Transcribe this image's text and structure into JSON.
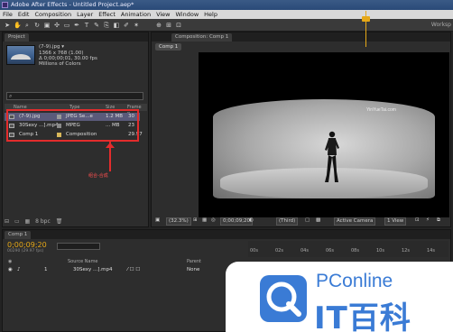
{
  "window": {
    "title": "Adobe After Effects - Untitled Project.aep*"
  },
  "menu": [
    "File",
    "Edit",
    "Composition",
    "Layer",
    "Effect",
    "Animation",
    "View",
    "Window",
    "Help"
  ],
  "toolbar": {
    "workspace": "Worksp"
  },
  "project": {
    "tab": "Project",
    "selected_item": {
      "name": "(7-9).jpg ▾",
      "dims": "1366 x 768 (1.00)",
      "duration": "Δ 0;00;00;01, 30.00 fps",
      "colors": "Millions of Colors"
    },
    "columns": [
      "Name",
      "Type",
      "Size",
      "Frame R..."
    ],
    "items": [
      {
        "name": "(7-9).jpg",
        "type": "JPEG Se...e",
        "size": "1.2 MB",
        "frame": "30",
        "swatch": "#9a9a9a"
      },
      {
        "name": "30Sexy ...].mp4",
        "type": "MPEG",
        "size": "... MB",
        "frame": "23",
        "swatch": "#8a8a8a"
      },
      {
        "name": "Comp 1",
        "type": "Composition",
        "size": "",
        "frame": "29.97",
        "swatch": "#d9b85a"
      }
    ],
    "annotation": "组合-合成",
    "footer_bpc": "8 bpc"
  },
  "composition": {
    "tab": "Composition: Comp 1",
    "comp_tab": "Comp 1",
    "video_watermark": "YinYueTai.com",
    "zoom": "(32.3%)",
    "timecode": "0;00;09;20",
    "resolution": "(Third)",
    "camera": "Active Camera",
    "view": "1 View"
  },
  "timeline": {
    "tab": "Comp 1",
    "time": "0;00;09;20",
    "fps": "00290 (29.97 fps)",
    "headers": {
      "source": "Source Name",
      "parent": "Parent"
    },
    "layer": {
      "index": "1",
      "name": "30Sexy ...].mp4",
      "parent": "None"
    },
    "ruler": [
      "00s",
      "02s",
      "04s",
      "06s",
      "08s",
      "10s",
      "12s",
      "14s"
    ]
  },
  "watermark": {
    "brand": "PConline",
    "cn": "IT百科"
  },
  "colors": {
    "accent_time": "#e6a817",
    "highlight": "#e32c2c",
    "pc_blue": "#3a7bd5"
  }
}
